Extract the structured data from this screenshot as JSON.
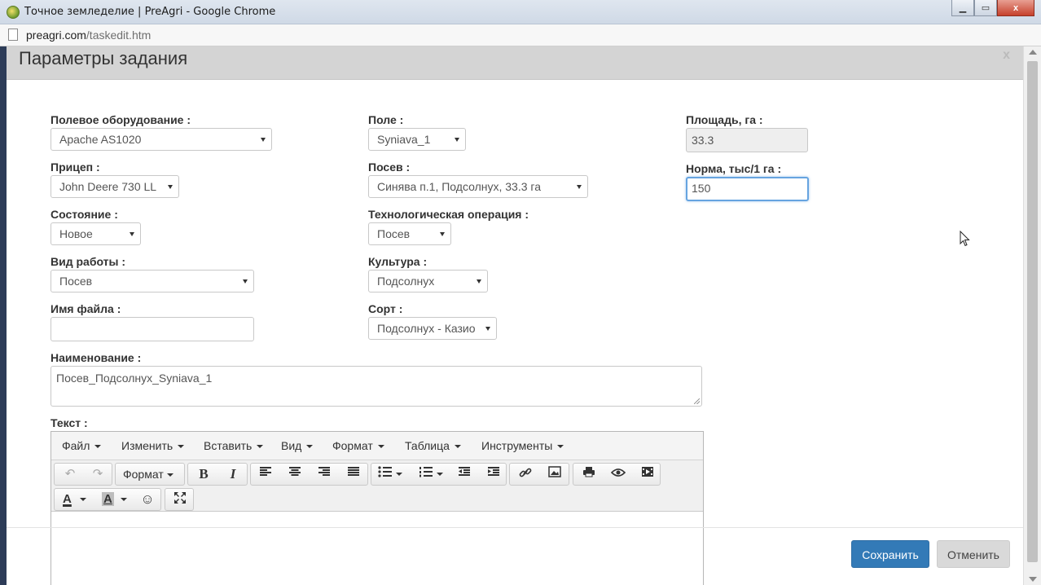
{
  "window": {
    "title": "Точное земледелие | PreAgri - Google Chrome",
    "url_host": "preagri.com",
    "url_path": "/taskedit.htm",
    "minimize": "▁",
    "maximize": "▭",
    "close": "x"
  },
  "modal": {
    "title": "Параметры задания",
    "close_label": "x"
  },
  "form": {
    "equipment": {
      "label": "Полевое оборудование :",
      "value": "Apache AS1020"
    },
    "field": {
      "label": "Поле :",
      "value": "Syniava_1"
    },
    "area": {
      "label": "Площадь, га :",
      "value": "33.3"
    },
    "trailer": {
      "label": "Прицеп :",
      "value": "John Deere 730 LL"
    },
    "sowing": {
      "label": "Посев :",
      "value": "Синява п.1, Подсолнух, 33.3 га"
    },
    "rate": {
      "label": "Норма, тыс/1 га :",
      "value": "150"
    },
    "state": {
      "label": "Состояние :",
      "value": "Новое"
    },
    "operation": {
      "label": "Технологическая операция :",
      "value": "Посев"
    },
    "work_type": {
      "label": "Вид работы :",
      "value": "Посев"
    },
    "culture": {
      "label": "Культура :",
      "value": "Подсолнух"
    },
    "filename": {
      "label": "Имя файла :",
      "value": ""
    },
    "variety": {
      "label": "Сорт :",
      "value": "Подсолнух - Казио"
    },
    "name": {
      "label": "Наименование :",
      "value": "Посев_Подсолнух_Syniava_1"
    },
    "text": {
      "label": "Текст :"
    }
  },
  "editor": {
    "menu": [
      "Файл",
      "Изменить",
      "Вставить",
      "Вид",
      "Формат",
      "Таблица",
      "Инструменты"
    ],
    "format_label": "Формат",
    "bold": "B",
    "italic": "I",
    "font_color": "A",
    "bg_color": "A"
  },
  "buttons": {
    "save": "Сохранить",
    "cancel": "Отменить"
  },
  "colors": {
    "primary": "#337ab7",
    "focus": "#66a4e0"
  }
}
